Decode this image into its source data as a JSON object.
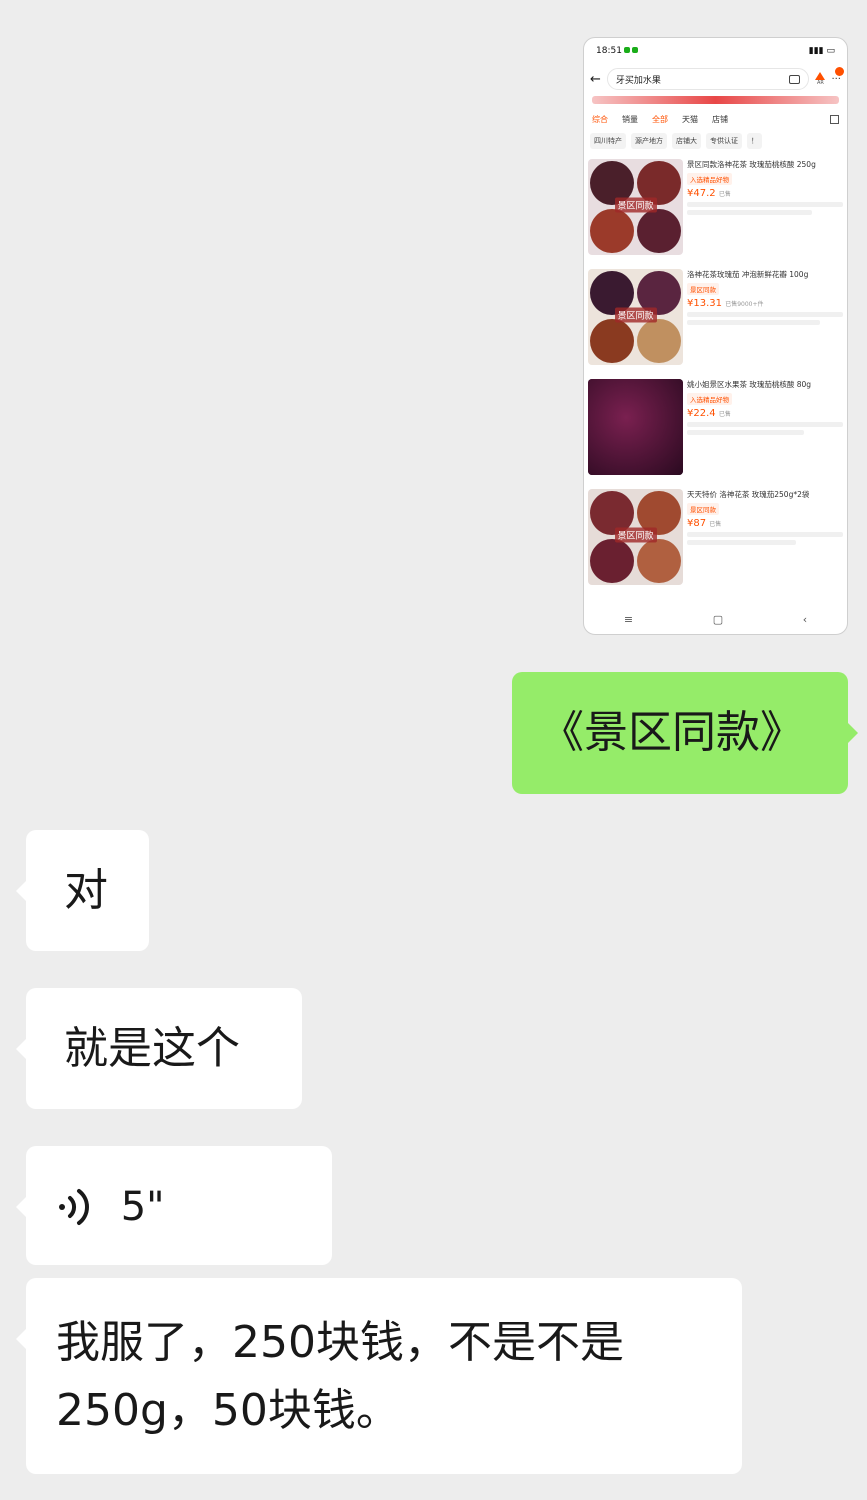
{
  "screenshot": {
    "status_time": "18:51",
    "search_query": "牙买加水果",
    "tabs": [
      "综合",
      "销量",
      "全部",
      "天猫",
      "店铺"
    ],
    "active_tab_index": 2,
    "chips": [
      "四川特产",
      "源产地方",
      "店铺大",
      "专供认证",
      "！"
    ],
    "products": [
      {
        "title": "景区同款洛神花茶 玫瑰茄桃核酸 250g",
        "badge": "入选精品好物",
        "price": "¥47.2",
        "sold": "已售"
      },
      {
        "title": "洛神花茶玫瑰茄 冲泡新鲜花瓣 100g",
        "badge": "景区同款",
        "price": "¥13.31",
        "sold": "已售9000+件"
      },
      {
        "title": "姚小姐景区水果茶 玫瑰茄桃核酸 80g",
        "badge": "入选精品好物",
        "price": "¥22.4",
        "sold": "已售"
      },
      {
        "title": "天天特价 洛神花茶 玫瑰茄250g*2袋",
        "badge": "景区同款",
        "price": "¥87",
        "sold": "已售"
      }
    ],
    "thumb_labels": [
      "景区同款",
      "景区同款",
      "",
      "景区同款"
    ],
    "nav_icons": [
      "menu-icon",
      "home-square-icon",
      "back-icon"
    ]
  },
  "messages": {
    "sent_1": "《景区同款》",
    "recv_1": "对",
    "recv_2": "就是这个",
    "voice_duration": "5\"",
    "recv_3_line1": "我服了，250块钱，不是不是",
    "recv_3_line2": "250g，50块钱。"
  },
  "colors": {
    "chat_bg": "#ededed",
    "incoming_bubble": "#ffffff",
    "outgoing_bubble": "#95ec69",
    "accent": "#ff5000"
  }
}
